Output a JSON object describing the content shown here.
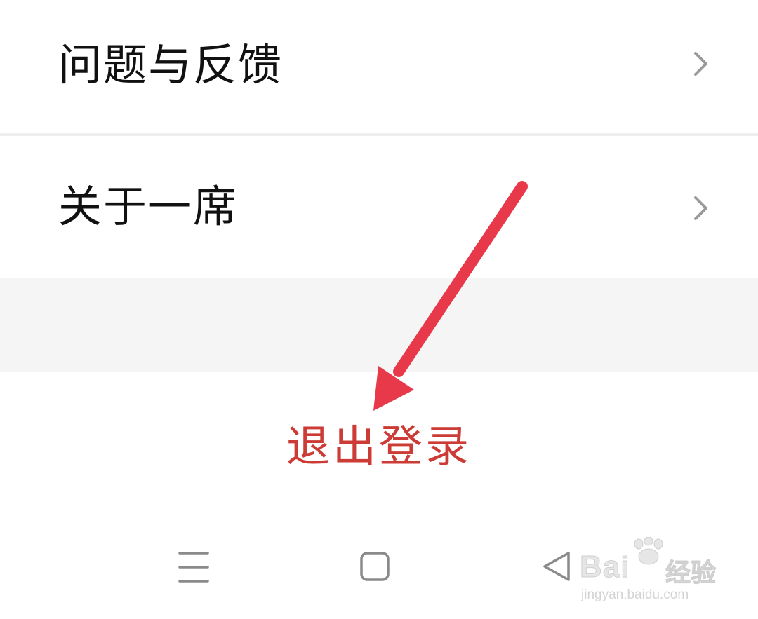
{
  "settings": {
    "items": [
      {
        "label": "问题与反馈"
      },
      {
        "label": "关于一席"
      }
    ],
    "logout_label": "退出登录"
  },
  "navbar": {
    "buttons": [
      "menu-icon",
      "home-icon",
      "back-icon"
    ]
  },
  "watermark": {
    "brand": "Bai",
    "brand_suffix": "经验",
    "url": "jingyan.baidu.com"
  },
  "colors": {
    "logout_text": "#cc3b35",
    "arrow": "#e8394a",
    "separator_gap": "#f5f5f5",
    "chevron": "#9a9a9a"
  }
}
